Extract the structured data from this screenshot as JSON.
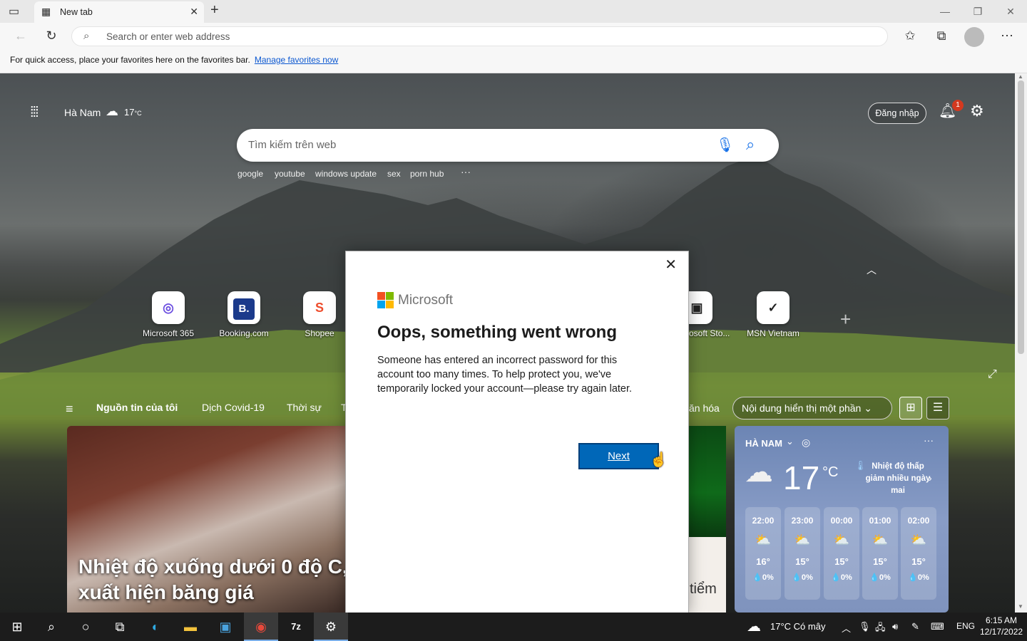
{
  "browser": {
    "tab_title": "New tab",
    "address_placeholder": "Search or enter web address",
    "favorites_message": "For quick access, place your favorites here on the favorites bar.",
    "favorites_link": "Manage favorites now"
  },
  "newtab": {
    "location": "Hà Nam",
    "temperature": "17",
    "temp_unit": "°C",
    "signin": "Đăng nhập",
    "notification_count": "1",
    "search_placeholder": "Tìm kiếm trên web",
    "suggestions": [
      "google",
      "youtube",
      "windows update",
      "sex",
      "porn hub",
      "···"
    ],
    "tiles": [
      {
        "label": "Microsoft 365",
        "glyph": "◎",
        "color": "#6b4ee0"
      },
      {
        "label": "Booking.com",
        "glyph": "B.",
        "color": "#1b3a8b"
      },
      {
        "label": "Shopee",
        "glyph": "S",
        "color": "#ee4d2d"
      },
      {
        "label": "osoft Sto...",
        "glyph": "▣",
        "color": "#222222"
      },
      {
        "label": "MSN Vietnam",
        "glyph": "✓",
        "color": "#222222"
      }
    ],
    "feed_tabs": [
      "Nguồn tin của tôi",
      "Dịch Covid-19",
      "Thời sự",
      "T",
      "ăn hóa"
    ],
    "content_toggle": "Nội dung hiển thị một phần",
    "news_headline_1": "Nhiệt độ xuống dưới 0 độ C, c",
    "news_headline_2": "xuất hiện băng giá",
    "right_card_text": "tiểm",
    "weather": {
      "title": "HÀ NAM",
      "temp": "17",
      "unit": "°C",
      "note_1": "Nhiệt độ thấp",
      "note_2": "giảm nhiều ngày",
      "note_3": "mai",
      "more": "···",
      "hours": [
        {
          "time": "22:00",
          "temp": "16°",
          "rain": "💧0%"
        },
        {
          "time": "23:00",
          "temp": "15°",
          "rain": "💧0%"
        },
        {
          "time": "00:00",
          "temp": "15°",
          "rain": "💧0%"
        },
        {
          "time": "01:00",
          "temp": "15°",
          "rain": "💧0%"
        },
        {
          "time": "02:00",
          "temp": "15°",
          "rain": "💧0%"
        }
      ]
    }
  },
  "dialog": {
    "brand": "Microsoft",
    "title": "Oops, something went wrong",
    "message": "Someone has entered an incorrect password for this account too many times. To help protect you, we've temporarily locked your account—please try again later.",
    "next_label": "Next"
  },
  "taskbar": {
    "weather": "17°C  Có mây",
    "lang": "ENG",
    "time": "6:15 AM",
    "date": "12/17/2022"
  }
}
